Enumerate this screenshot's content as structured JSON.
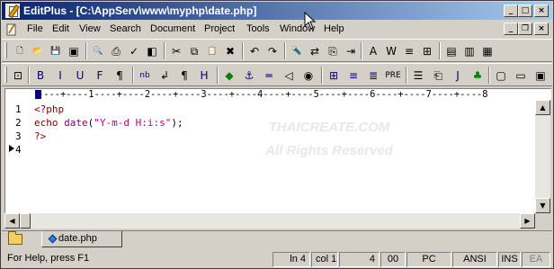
{
  "window": {
    "title": "EditPlus - [C:\\AppServ\\www\\myphp\\date.php]",
    "controls": {
      "minimize": "_",
      "maximize": "□",
      "close": "×"
    }
  },
  "menu": {
    "items": [
      "File",
      "Edit",
      "View",
      "Search",
      "Document",
      "Project",
      "Tools",
      "Window",
      "Help"
    ],
    "mdi_controls": {
      "minimize": "_",
      "restore": "❐",
      "close": "×"
    }
  },
  "toolbar1": {
    "tools": [
      {
        "icon": "new-file-icon",
        "glyph": "🗋"
      },
      {
        "icon": "open-folder-icon",
        "glyph": "📂"
      },
      {
        "icon": "save-icon",
        "glyph": "💾"
      },
      {
        "icon": "save-all-icon",
        "glyph": "▣"
      },
      {
        "icon": "print-preview-icon",
        "glyph": "🔍"
      },
      {
        "icon": "print-icon",
        "glyph": "⎙"
      },
      {
        "icon": "spell-check-icon",
        "glyph": "✓"
      },
      {
        "icon": "browser-view-icon",
        "glyph": "◧"
      },
      {
        "icon": "cut-icon",
        "glyph": "✂"
      },
      {
        "icon": "copy-icon",
        "glyph": "⧉"
      },
      {
        "icon": "paste-icon",
        "glyph": "📋"
      },
      {
        "icon": "delete-icon",
        "glyph": "✖"
      },
      {
        "icon": "undo-icon",
        "glyph": "↶"
      },
      {
        "icon": "redo-icon",
        "glyph": "↷"
      },
      {
        "icon": "find-icon",
        "glyph": "🔦"
      },
      {
        "icon": "replace-icon",
        "glyph": "⇄"
      },
      {
        "icon": "find-in-files-icon",
        "glyph": "⎘"
      },
      {
        "icon": "goto-line-icon",
        "glyph": "⇥"
      },
      {
        "icon": "font-icon",
        "glyph": "A"
      },
      {
        "icon": "word-wrap-icon",
        "glyph": "W"
      },
      {
        "icon": "line-number-icon",
        "glyph": "≡"
      },
      {
        "icon": "column-marker-icon",
        "glyph": "⊞"
      },
      {
        "icon": "cliptext-icon",
        "glyph": "▤"
      },
      {
        "icon": "directory-window-icon",
        "glyph": "▥"
      },
      {
        "icon": "extra-icon",
        "glyph": "▦"
      }
    ]
  },
  "toolbar2": {
    "tools": [
      {
        "icon": "html-toolbar-icon",
        "glyph": "⊡",
        "color": "#000"
      },
      {
        "icon": "bold-icon",
        "glyph": "B",
        "color": "#000080"
      },
      {
        "icon": "italic-icon",
        "glyph": "I",
        "color": "#000080"
      },
      {
        "icon": "underline-icon",
        "glyph": "U",
        "color": "#000080"
      },
      {
        "icon": "font-tag-icon",
        "glyph": "F",
        "color": "#000080"
      },
      {
        "icon": "paragraph-icon",
        "glyph": "¶",
        "color": "#000"
      },
      {
        "icon": "nbsp-icon",
        "glyph": "nb",
        "color": "#000080"
      },
      {
        "icon": "line-break-icon",
        "glyph": "↲",
        "color": "#000"
      },
      {
        "icon": "pilcrow-icon",
        "glyph": "¶",
        "color": "#000"
      },
      {
        "icon": "heading-icon",
        "glyph": "H",
        "color": "#000080"
      },
      {
        "icon": "color-icon",
        "glyph": "◆",
        "color": "#008000"
      },
      {
        "icon": "anchor-icon",
        "glyph": "⚓",
        "color": "#000080"
      },
      {
        "icon": "hr-icon",
        "glyph": "═",
        "color": "#000080"
      },
      {
        "icon": "comment-icon",
        "glyph": "◁",
        "color": "#000"
      },
      {
        "icon": "image-icon",
        "glyph": "◉",
        "color": "#000"
      },
      {
        "icon": "table-icon",
        "glyph": "⊞",
        "color": "#000080"
      },
      {
        "icon": "align-center-icon",
        "glyph": "≡",
        "color": "#000080"
      },
      {
        "icon": "align-right-icon",
        "glyph": "≣",
        "color": "#000080"
      },
      {
        "icon": "pre-icon",
        "glyph": "PRE",
        "color": "#000"
      },
      {
        "icon": "list-icon",
        "glyph": "☰",
        "color": "#000"
      },
      {
        "icon": "script-icon",
        "glyph": "⎗",
        "color": "#000"
      },
      {
        "icon": "javascript-icon",
        "glyph": "J",
        "color": "#000080"
      },
      {
        "icon": "css-icon",
        "glyph": "♣",
        "color": "#008000"
      },
      {
        "icon": "form-icon",
        "glyph": "▢",
        "color": "#000"
      },
      {
        "icon": "input-icon",
        "glyph": "▭",
        "color": "#000"
      },
      {
        "icon": "textarea-icon",
        "glyph": "▣",
        "color": "#000"
      }
    ]
  },
  "ruler": {
    "text": "----+----1----+----2----+----3----+----4----+----5----+----6----+----7----+----8"
  },
  "editor": {
    "line_numbers": [
      "1",
      "2",
      "3",
      "4"
    ],
    "lines": [
      [
        {
          "t": "<?php",
          "c": "kw"
        }
      ],
      [
        {
          "t": "echo ",
          "c": "kw"
        },
        {
          "t": "date",
          "c": "fn"
        },
        {
          "t": "(",
          "c": "pun"
        },
        {
          "t": "\"Y-m-d H:i:s\"",
          "c": "str"
        },
        {
          "t": ");",
          "c": "pun"
        }
      ],
      [
        {
          "t": "?>",
          "c": "kw"
        }
      ],
      []
    ],
    "watermark": [
      "THAICREATE.COM",
      "All Rights Reserved"
    ]
  },
  "tabs": {
    "files": [
      "date.php"
    ]
  },
  "status": {
    "help": "For Help, press F1",
    "line": "ln 4",
    "col": "col 1",
    "count": "4",
    "hex": "00",
    "mode": "PC",
    "encoding": "ANSI",
    "insert": "INS",
    "ext": "EA"
  }
}
